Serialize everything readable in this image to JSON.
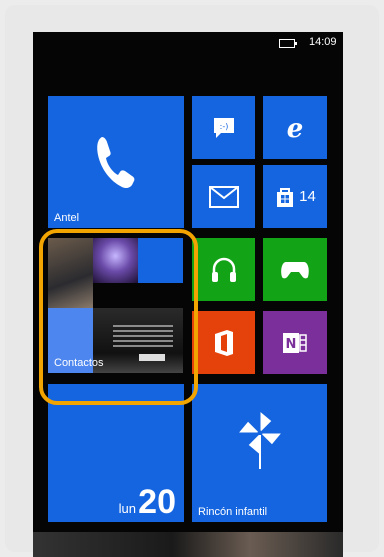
{
  "status_bar": {
    "time": "14:09",
    "battery_icon": "battery-icon"
  },
  "tiles": {
    "phone": {
      "label": "Antel",
      "icon": "phone-icon",
      "color": "#1565e0"
    },
    "messaging": {
      "icon": "chat-bubble-icon",
      "color": "#1565e0"
    },
    "internet_explorer": {
      "icon": "internet-explorer-icon",
      "color": "#1565e0"
    },
    "mail": {
      "icon": "mail-icon",
      "color": "#1565e0"
    },
    "store": {
      "icon": "store-icon",
      "badge": "14",
      "color": "#1565e0"
    },
    "music": {
      "icon": "headphones-icon",
      "color": "#12a317"
    },
    "xbox_games": {
      "icon": "xbox-controller-icon",
      "color": "#12a317"
    },
    "office": {
      "icon": "office-icon",
      "color": "#e5420b"
    },
    "onenote": {
      "icon": "onenote-icon",
      "color": "#7a2f9a"
    },
    "contacts": {
      "label": "Contactos",
      "color": "#1565e0"
    },
    "calendar": {
      "day": "lun",
      "date": "20",
      "color": "#1565e0"
    },
    "kids_corner": {
      "label": "Rincón infantil",
      "icon": "pinwheel-icon",
      "color": "#1565e0"
    }
  },
  "highlight_color": "#f2a400"
}
